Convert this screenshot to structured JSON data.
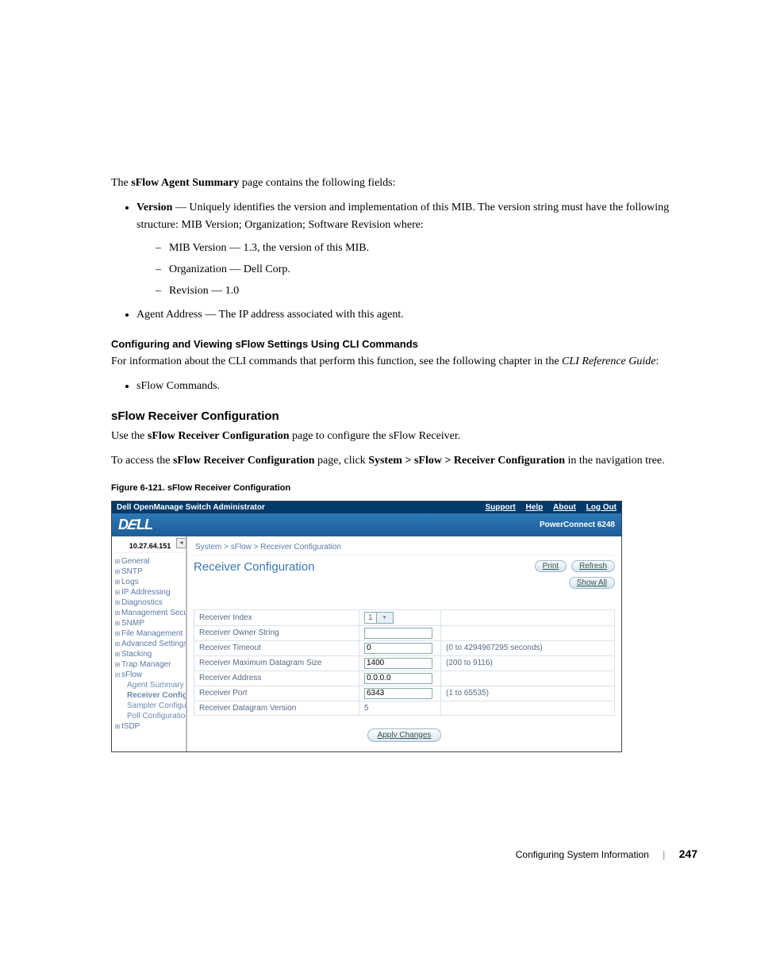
{
  "intro": {
    "prefix": "The ",
    "bold": "sFlow Agent Summary",
    "suffix": " page contains the following fields:"
  },
  "bullets": {
    "version": {
      "label": "Version",
      "text": " — Uniquely identifies the version and implementation of this MIB. The version string must have the following structure: MIB Version; Organization; Software Revision where:"
    },
    "sub": [
      "MIB Version — 1.3, the version of this MIB.",
      "Organization — Dell Corp.",
      "Revision — 1.0"
    ],
    "agent": "Agent Address — The IP address associated with this agent."
  },
  "cli": {
    "heading": "Configuring and Viewing sFlow Settings Using CLI Commands",
    "para_a": "For information about the CLI commands that perform this function, see the following chapter in the ",
    "para_italic": "CLI Reference Guide",
    "para_b": ":",
    "item": "sFlow Commands."
  },
  "sflow": {
    "heading": "sFlow Receiver Configuration",
    "p1a": "Use the ",
    "p1b": "sFlow Receiver Configuration",
    "p1c": " page to configure the sFlow Receiver.",
    "p2a": "To access the ",
    "p2b": "sFlow Receiver Configuration",
    "p2c": " page, click ",
    "p2path": "System > sFlow > Receiver Configuration",
    "p2d": " in the navigation tree."
  },
  "figure": {
    "caption": "Figure 6-121.    sFlow Receiver Configuration"
  },
  "ui": {
    "topbar": {
      "title": "Dell OpenManage Switch Administrator",
      "links": [
        "Support",
        "Help",
        "About",
        "Log Out"
      ]
    },
    "brand": "DELL",
    "model": "PowerConnect 6248",
    "ip": "10.27.64.151",
    "breadcrumb": "System > sFlow > Receiver Configuration",
    "nav": [
      "General",
      "SNTP",
      "Logs",
      "IP Addressing",
      "Diagnostics",
      "Management Secur",
      "SNMP",
      "File Management",
      "Advanced Settings",
      "Stacking",
      "Trap Manager",
      "sFlow"
    ],
    "nav_sub": [
      "Agent Summary",
      "Receiver Configur",
      "Sampler Configur",
      "Poll Configuration"
    ],
    "nav_after": "ISDP",
    "title": "Receiver Configuration",
    "buttons": {
      "print": "Print",
      "refresh": "Refresh",
      "showall": "Show All",
      "apply": "Apply Changes"
    },
    "rows": [
      {
        "label": "Receiver Index",
        "value": "1",
        "type": "select",
        "hint": ""
      },
      {
        "label": "Receiver Owner String",
        "value": "",
        "type": "input",
        "hint": ""
      },
      {
        "label": "Receiver Timeout",
        "value": "0",
        "type": "input",
        "hint": "(0 to 4294967295 seconds)"
      },
      {
        "label": "Receiver Maximum Datagram Size",
        "value": "1400",
        "type": "input",
        "hint": "(200 to 9116)"
      },
      {
        "label": "Receiver Address",
        "value": "0.0.0.0",
        "type": "input",
        "hint": ""
      },
      {
        "label": "Receiver Port",
        "value": "6343",
        "type": "input",
        "hint": "(1 to 65535)"
      },
      {
        "label": "Receiver Datagram Version",
        "value": "5",
        "type": "static",
        "hint": ""
      }
    ]
  },
  "footer": {
    "section": "Configuring System Information",
    "page": "247"
  }
}
